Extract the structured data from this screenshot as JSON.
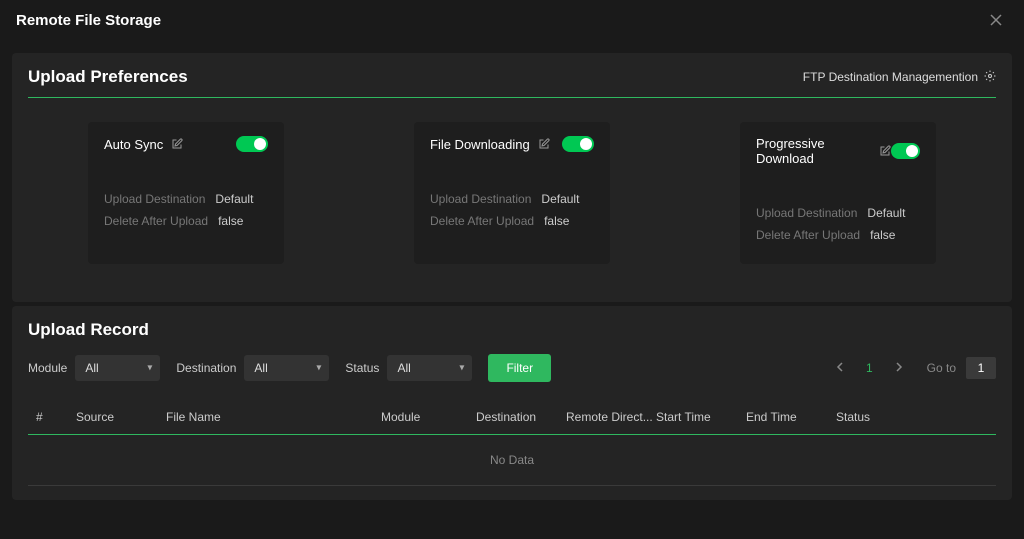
{
  "header": {
    "title": "Remote File Storage"
  },
  "preferences": {
    "title": "Upload Preferences",
    "link": "FTP Destination Managemention",
    "cards": [
      {
        "title": "Auto Sync",
        "upload_dest_label": "Upload Destination",
        "upload_dest": "Default",
        "delete_label": "Delete After Upload",
        "delete_value": "false"
      },
      {
        "title": "File Downloading",
        "upload_dest_label": "Upload Destination",
        "upload_dest": "Default",
        "delete_label": "Delete After Upload",
        "delete_value": "false"
      },
      {
        "title": "Progressive Download",
        "upload_dest_label": "Upload Destination",
        "upload_dest": "Default",
        "delete_label": "Delete After Upload",
        "delete_value": "false"
      }
    ]
  },
  "record": {
    "title": "Upload Record",
    "filters": {
      "module_label": "Module",
      "module_value": "All",
      "destination_label": "Destination",
      "destination_value": "All",
      "status_label": "Status",
      "status_value": "All",
      "filter_btn": "Filter"
    },
    "pagination": {
      "current": "1",
      "goto_label": "Go to",
      "goto_value": "1"
    },
    "columns": {
      "num": "#",
      "source": "Source",
      "file": "File Name",
      "module": "Module",
      "dest": "Destination",
      "remote": "Remote Direct...",
      "start": "Start Time",
      "end": "End Time",
      "status": "Status"
    },
    "no_data": "No Data"
  }
}
